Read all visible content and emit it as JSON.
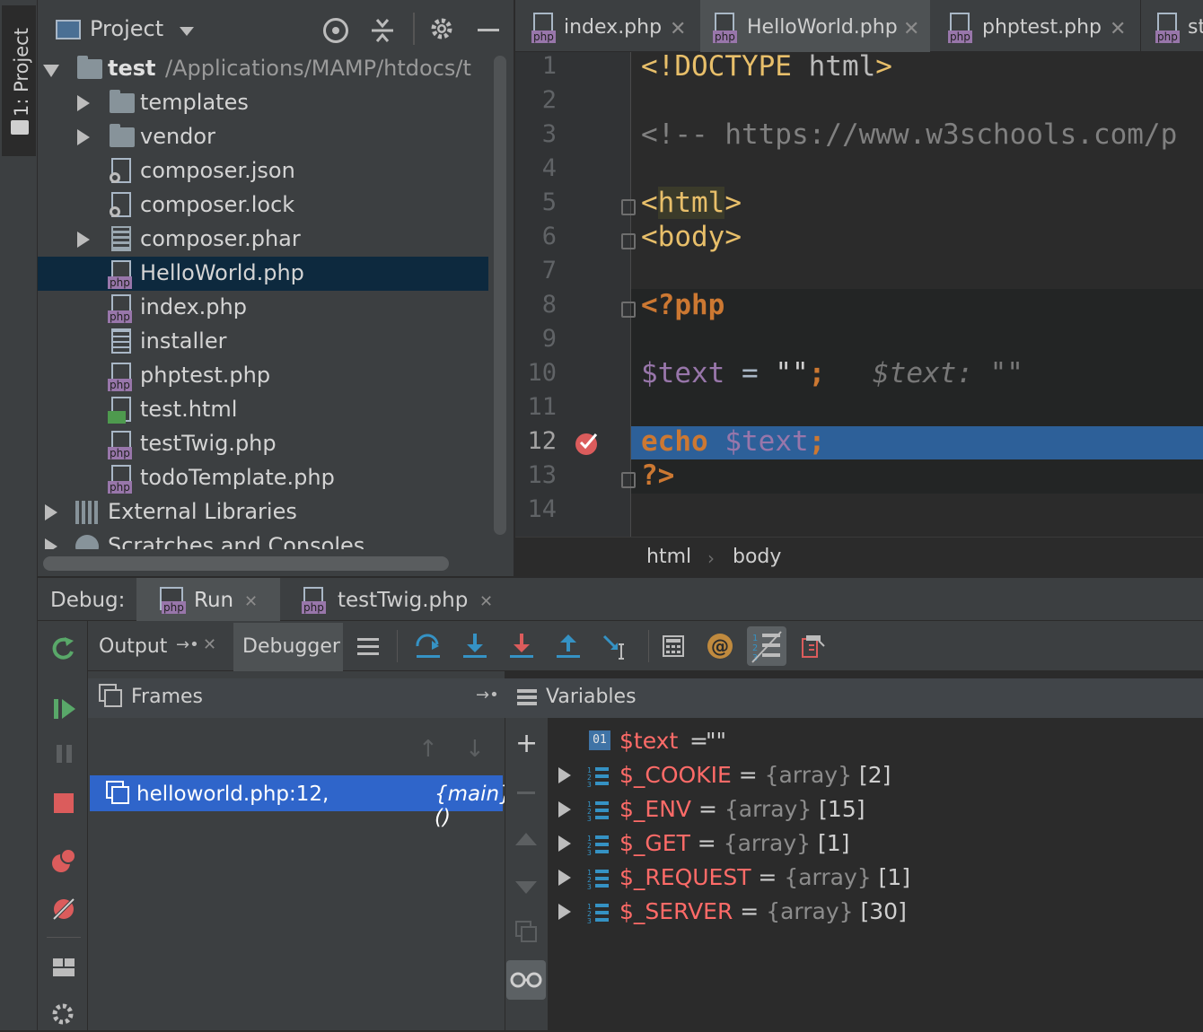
{
  "sidebar_tab": "1: Project",
  "project": {
    "title": "Project",
    "root": {
      "name": "test",
      "path": "/Applications/MAMP/htdocs/t"
    },
    "items": [
      {
        "label": "templates",
        "type": "folder",
        "expandable": true
      },
      {
        "label": "vendor",
        "type": "folder",
        "expandable": true
      },
      {
        "label": "composer.json",
        "type": "json"
      },
      {
        "label": "composer.lock",
        "type": "json"
      },
      {
        "label": "composer.phar",
        "type": "archive",
        "expandable": true
      },
      {
        "label": "HelloWorld.php",
        "type": "php",
        "selected": true
      },
      {
        "label": "index.php",
        "type": "php"
      },
      {
        "label": "installer",
        "type": "text"
      },
      {
        "label": "phptest.php",
        "type": "php"
      },
      {
        "label": "test.html",
        "type": "html"
      },
      {
        "label": "testTwig.php",
        "type": "php"
      },
      {
        "label": "todoTemplate.php",
        "type": "php"
      }
    ],
    "external_libraries": "External Libraries",
    "scratches": "Scratches and Consoles"
  },
  "editor": {
    "tabs": [
      {
        "label": "index.php",
        "active": false
      },
      {
        "label": "HelloWorld.php",
        "active": true
      },
      {
        "label": "phptest.php",
        "active": false
      },
      {
        "label": "st",
        "active": false
      }
    ],
    "file_badge": "php",
    "line_numbers": [
      "1",
      "2",
      "3",
      "4",
      "5",
      "6",
      "7",
      "8",
      "9",
      "10",
      "11",
      "12",
      "13",
      "14"
    ],
    "current_line": "12",
    "lines": {
      "l1_a": "<!DOCTYPE ",
      "l1_b": "html",
      "l1_c": ">",
      "l3": "<!-- https://www.w3schools.com/p",
      "l5_a": "<",
      "l5_b": "html",
      "l5_c": ">",
      "l6_a": "<",
      "l6_b": "body",
      "l6_c": ">",
      "l8": "<?php",
      "l10_var": "$text",
      "l10_eq": " = ",
      "l10_str": "\"\"",
      "l10_semi": ";",
      "l10_inline": "$text: \"\"",
      "l12_kw": "echo ",
      "l12_var": "$text",
      "l12_semi": ";",
      "l13": "?>"
    },
    "breadcrumb": [
      "html",
      "body"
    ]
  },
  "debug": {
    "label": "Debug:",
    "tabs": [
      {
        "label": "Run",
        "active": true
      },
      {
        "label": "testTwig.php",
        "active": false
      }
    ],
    "subtabs": {
      "output": "Output",
      "debugger": "Debugger"
    },
    "frames": {
      "title": "Frames",
      "entries": [
        {
          "location": "helloworld.php:12, ",
          "function": "{main}()"
        }
      ]
    },
    "variables": {
      "title": "Variables",
      "items": [
        {
          "name": "$text",
          "eq": " = ",
          "type": "",
          "value": "\"\"",
          "kind": "scalar",
          "expandable": false
        },
        {
          "name": "$_COOKIE",
          "eq": " = ",
          "type": "{array}",
          "value": " [2]",
          "kind": "array",
          "expandable": true
        },
        {
          "name": "$_ENV",
          "eq": " = ",
          "type": "{array}",
          "value": " [15]",
          "kind": "array",
          "expandable": true
        },
        {
          "name": "$_GET",
          "eq": " = ",
          "type": "{array}",
          "value": " [1]",
          "kind": "array",
          "expandable": true
        },
        {
          "name": "$_REQUEST",
          "eq": " = ",
          "type": "{array}",
          "value": " [1]",
          "kind": "array",
          "expandable": true
        },
        {
          "name": "$_SERVER",
          "eq": " = ",
          "type": "{array}",
          "value": " [30]",
          "kind": "array",
          "expandable": true
        }
      ]
    }
  },
  "colors": {
    "panel_bg": "#3c3f41",
    "editor_bg": "#2b2b2b",
    "selection": "#0d293e",
    "exec_line": "#2d6099",
    "frame_selected": "#2f65ca",
    "var_name": "#ff6b68",
    "tag": "#e8bf6a",
    "keyword": "#cc7832"
  }
}
